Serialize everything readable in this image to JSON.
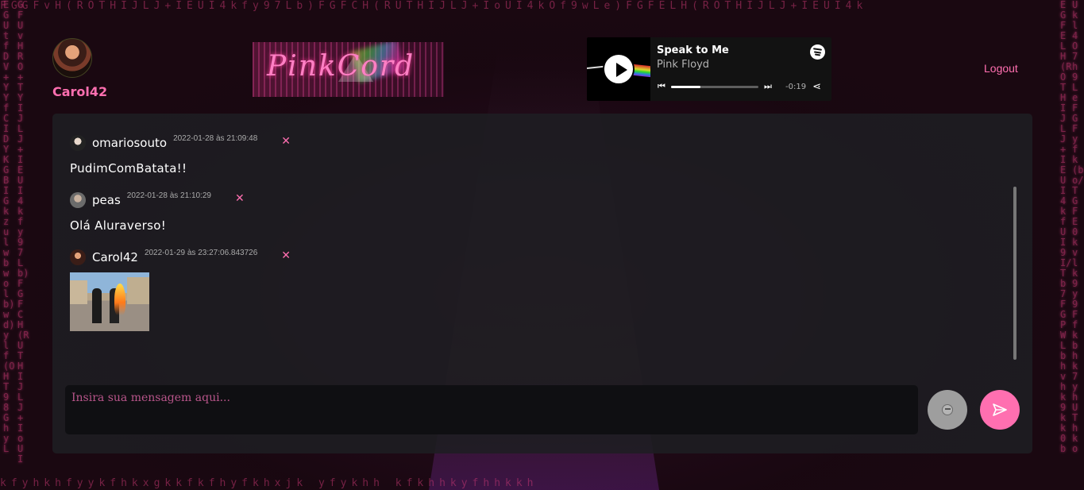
{
  "user": {
    "name": "Carol42"
  },
  "logo": {
    "text": "PinkCord"
  },
  "player": {
    "track": "Speak to Me",
    "artist": "Pink Floyd",
    "time_remaining": "-0:19",
    "progress": 0.34,
    "icons": [
      "play-icon",
      "spotify-icon",
      "previous-icon",
      "next-icon",
      "share-icon"
    ]
  },
  "header": {
    "logout_label": "Logout"
  },
  "messages": [
    {
      "author": "omariosouto",
      "date": "2022-01-28 às 21:09:48",
      "text": "PudimComBatata!!",
      "delete_label": "✕"
    },
    {
      "author": "peas",
      "date": "2022-01-28 às 21:10:29",
      "text": "Olá Aluraverso!",
      "delete_label": "✕"
    },
    {
      "author": "Carol42",
      "date": "2022-01-29 às 23:27:06.843726",
      "delete_label": "✕",
      "sticker": "handshake-burning-man-image"
    }
  ],
  "composer": {
    "placeholder": "Insira sua mensagem aqui..."
  },
  "colors": {
    "accent": "#ff6fb0",
    "panel": "#1e1e22",
    "background": "#1a0811"
  }
}
